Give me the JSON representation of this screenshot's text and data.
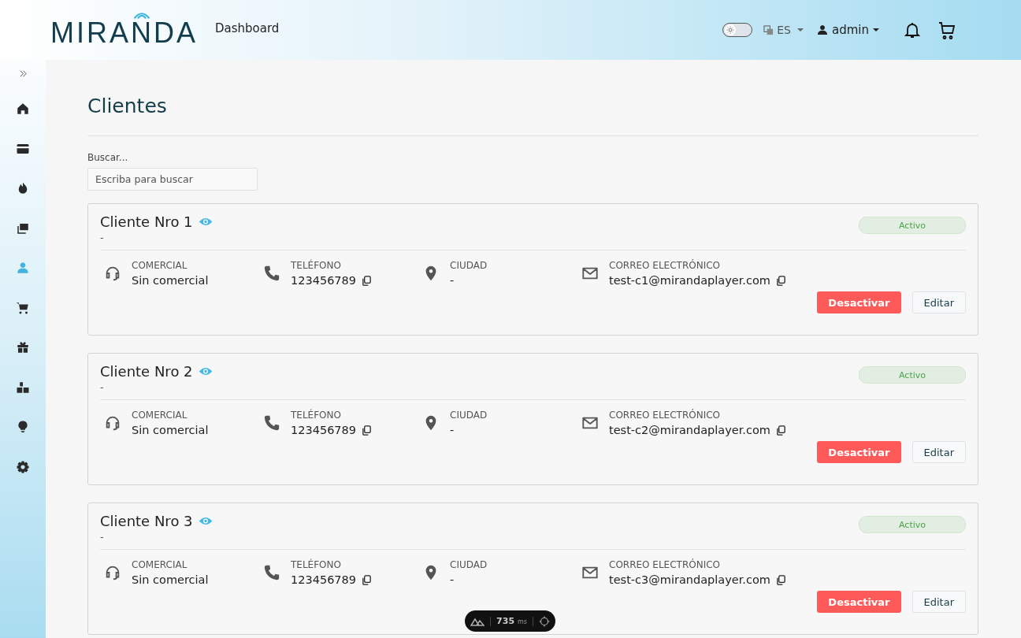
{
  "header": {
    "logo": "MIRANDA",
    "nav_link": "Dashboard",
    "theme_toggle": {
      "on": false
    },
    "language": "ES",
    "user": "admin"
  },
  "sidebar": {
    "items": [
      {
        "kind": "home",
        "selected": false
      },
      {
        "kind": "card",
        "selected": false
      },
      {
        "kind": "flame",
        "selected": false
      },
      {
        "kind": "images",
        "selected": false
      },
      {
        "kind": "user",
        "selected": true
      },
      {
        "kind": "cart",
        "selected": false
      },
      {
        "kind": "gift",
        "selected": false
      },
      {
        "kind": "boxes",
        "selected": false
      },
      {
        "kind": "bulb",
        "selected": false
      },
      {
        "kind": "gear",
        "selected": false
      }
    ]
  },
  "page": {
    "title": "Clientes",
    "search": {
      "label": "Buscar...",
      "placeholder": "Escriba para buscar"
    }
  },
  "clients": [
    {
      "name": "Cliente Nro 1",
      "subtitle": "-",
      "status": "Activo",
      "fields": [
        {
          "kind": "commercial",
          "label": "COMERCIAL",
          "value": "Sin comercial",
          "copyable": false
        },
        {
          "kind": "phone",
          "label": "TELÉFONO",
          "value": "123456789",
          "copyable": true
        },
        {
          "kind": "city",
          "label": "CIUDAD",
          "value": "-",
          "copyable": false
        },
        {
          "kind": "email",
          "label": "CORREO ELECTRÓNICO",
          "value": "test-c1@mirandaplayer.com",
          "copyable": true
        }
      ],
      "buttons": [
        "Desactivar",
        "Editar"
      ]
    },
    {
      "name": "Cliente Nro 2",
      "subtitle": "-",
      "status": "Activo",
      "fields": [
        {
          "kind": "commercial",
          "label": "COMERCIAL",
          "value": "Sin comercial",
          "copyable": false
        },
        {
          "kind": "phone",
          "label": "TELÉFONO",
          "value": "123456789",
          "copyable": true
        },
        {
          "kind": "city",
          "label": "CIUDAD",
          "value": "-",
          "copyable": false
        },
        {
          "kind": "email",
          "label": "CORREO ELECTRÓNICO",
          "value": "test-c2@mirandaplayer.com",
          "copyable": true
        }
      ],
      "buttons": [
        "Desactivar",
        "Editar"
      ]
    },
    {
      "name": "Cliente Nro 3",
      "subtitle": "-",
      "status": "Activo",
      "fields": [
        {
          "kind": "commercial",
          "label": "COMERCIAL",
          "value": "Sin comercial",
          "copyable": false
        },
        {
          "kind": "phone",
          "label": "TELÉFONO",
          "value": "123456789",
          "copyable": true
        },
        {
          "kind": "city",
          "label": "CIUDAD",
          "value": "-",
          "copyable": false
        },
        {
          "kind": "email",
          "label": "CORREO ELECTRÓNICO",
          "value": "test-c3@mirandaplayer.com",
          "copyable": true
        }
      ],
      "buttons": [
        "Desactivar",
        "Editar"
      ]
    }
  ],
  "devtools": {
    "timing": "735",
    "unit": "ms"
  }
}
